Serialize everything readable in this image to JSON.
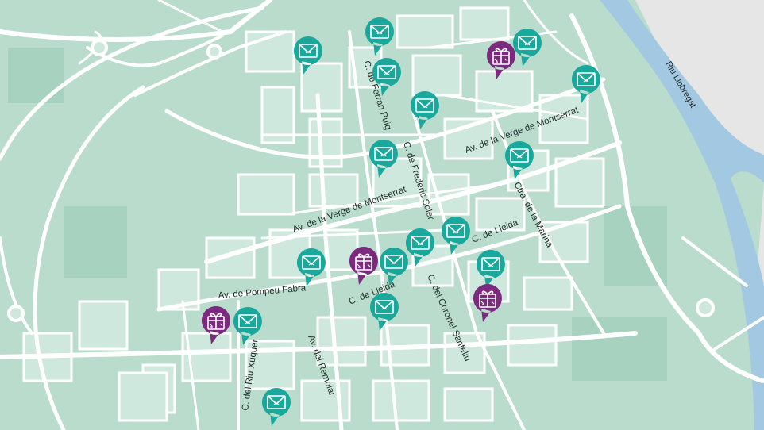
{
  "map": {
    "colors": {
      "land": "#b9dccd",
      "block": "#cfe8dd",
      "park": "#a6d2bf",
      "road": "#ffffff",
      "river": "#a3c9e2",
      "outside": "#e6e6e6",
      "mail_marker": "#1aa89c",
      "gift_marker": "#7b2a7d"
    },
    "river_label": "Riu Llobregat",
    "street_labels": [
      "C. de Ferran Puig",
      "C. de Frederic Soler",
      "Av. de la Verge de Montserrat",
      "Av. de la Verge de Montserrat",
      "Ctra. de la Marina",
      "C. de Lleida",
      "C. de Lleida",
      "Av. de Pompeu Fabra",
      "C. del Coronel Sanfeliu",
      "Av. del Remolar",
      "C. del Riu Xúquer"
    ],
    "markers": [
      {
        "type": "mail",
        "icon": "envelope-icon"
      },
      {
        "type": "mail",
        "icon": "envelope-icon"
      },
      {
        "type": "mail",
        "icon": "envelope-icon"
      },
      {
        "type": "gift",
        "icon": "gift-icon"
      },
      {
        "type": "mail",
        "icon": "envelope-icon"
      },
      {
        "type": "mail",
        "icon": "envelope-icon"
      },
      {
        "type": "mail",
        "icon": "envelope-icon"
      },
      {
        "type": "mail",
        "icon": "envelope-icon"
      },
      {
        "type": "mail",
        "icon": "envelope-icon"
      },
      {
        "type": "mail",
        "icon": "envelope-icon"
      },
      {
        "type": "mail",
        "icon": "envelope-icon"
      },
      {
        "type": "mail",
        "icon": "envelope-icon"
      },
      {
        "type": "gift",
        "icon": "gift-icon"
      },
      {
        "type": "mail",
        "icon": "envelope-icon"
      },
      {
        "type": "mail",
        "icon": "envelope-icon"
      },
      {
        "type": "gift",
        "icon": "gift-icon"
      },
      {
        "type": "mail",
        "icon": "envelope-icon"
      },
      {
        "type": "gift",
        "icon": "gift-icon"
      },
      {
        "type": "mail",
        "icon": "envelope-icon"
      },
      {
        "type": "mail",
        "icon": "envelope-icon"
      }
    ]
  }
}
